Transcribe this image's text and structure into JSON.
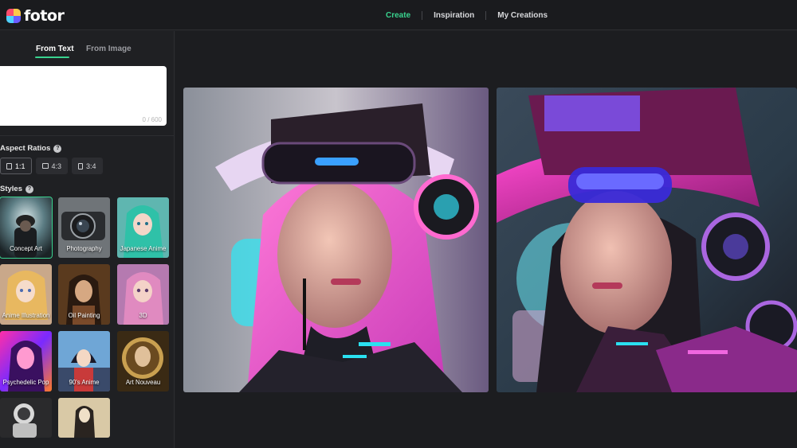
{
  "header": {
    "logo_text": "fotor",
    "nav": [
      {
        "label": "Create",
        "active": true
      },
      {
        "label": "Inspiration",
        "active": false
      },
      {
        "label": "My Creations",
        "active": false
      }
    ],
    "accent_color": "#39d38f"
  },
  "sidebar": {
    "tabs": [
      {
        "label": "From Text",
        "active": true
      },
      {
        "label": "From Image",
        "active": false
      }
    ],
    "prompt": {
      "value": "",
      "char_count": "0 / 600"
    },
    "aspect_ratios": {
      "label": "Aspect Ratios",
      "help_icon": "?",
      "options": [
        {
          "label": "1:1",
          "selected": true
        },
        {
          "label": "4:3",
          "selected": false
        },
        {
          "label": "3:4",
          "selected": false
        }
      ]
    },
    "styles": {
      "label": "Styles",
      "help_icon": "?",
      "items": [
        {
          "label": "Concept Art",
          "selected": true
        },
        {
          "label": "Photography",
          "selected": false
        },
        {
          "label": "Japanese Anime",
          "selected": false
        },
        {
          "label": "Anime Illustration",
          "selected": false
        },
        {
          "label": "Oil Painting",
          "selected": false
        },
        {
          "label": "3D",
          "selected": false
        },
        {
          "label": "Psychedelic Pop",
          "selected": false
        },
        {
          "label": "90's Anime",
          "selected": false
        },
        {
          "label": "Art Nouveau",
          "selected": false
        },
        {
          "label": "",
          "selected": false
        },
        {
          "label": "",
          "selected": false
        }
      ]
    }
  },
  "main": {
    "results": [
      {
        "subject": "cyberpunk woman with visor and headphones"
      },
      {
        "subject": "cyberpunk woman with pink hat and sunglasses"
      }
    ]
  }
}
